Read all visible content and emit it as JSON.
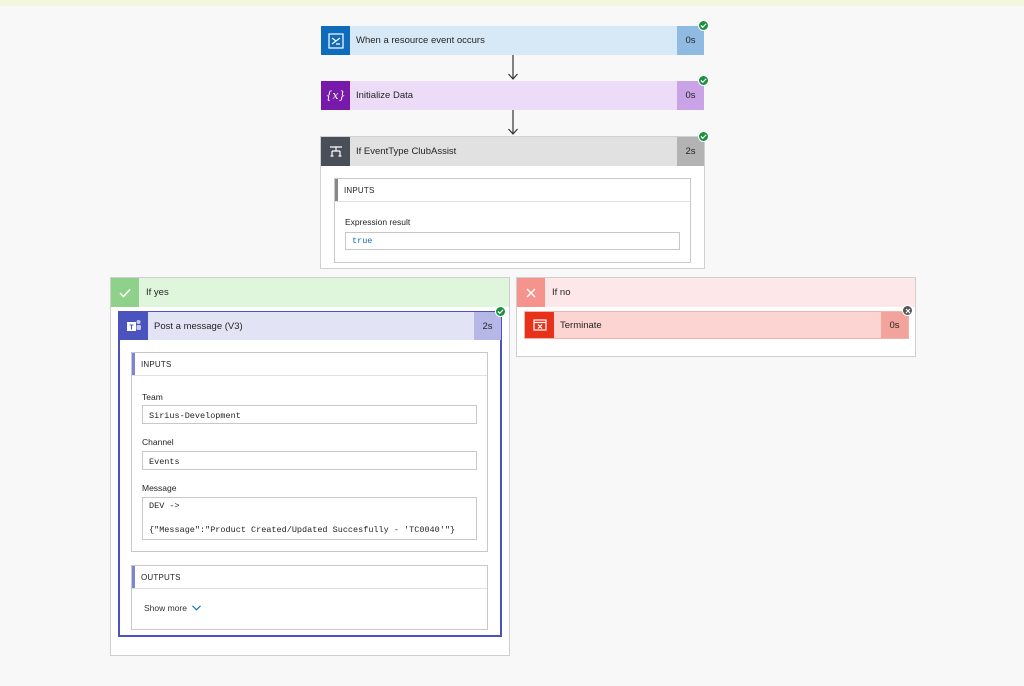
{
  "colors": {
    "trigger_bg": "#d7e9f6",
    "trigger_icon": "#0f6cbd",
    "trigger_dur": "#8fbbe2",
    "init_bg": "#ecdcf8",
    "init_icon": "#7719aa",
    "init_dur": "#c9a3e6",
    "cond_bg": "#e1e1e1",
    "cond_icon": "#484f58",
    "cond_dur": "#b3b3b3",
    "yes_bg": "#dff6dd",
    "yes_icon": "#8fd18b",
    "no_bg": "#fde7e9",
    "no_icon": "#f4948c",
    "teams_bg": "#e2e3f4",
    "teams_icon": "#4b53bc",
    "teams_dur": "#b5b8e6",
    "term_bg": "#fcd4d2",
    "term_icon": "#e8311a",
    "term_dur": "#f2a39b",
    "success": "#1a8f3d"
  },
  "steps": {
    "trigger": {
      "title": "When a resource event occurs",
      "duration": "0s",
      "icon": "event-grid-icon"
    },
    "init": {
      "title": "Initialize Data",
      "duration": "0s",
      "icon": "variable-icon"
    },
    "condition": {
      "title": "If EventType ClubAssist",
      "duration": "2s",
      "icon": "condition-icon",
      "inputs_header": "INPUTS",
      "expression_label": "Expression result",
      "expression_value": "true"
    }
  },
  "branches": {
    "yes": {
      "label": "If yes",
      "icon": "check-icon"
    },
    "no": {
      "label": "If no",
      "icon": "close-icon"
    }
  },
  "post_message": {
    "title": "Post a message (V3)",
    "duration": "2s",
    "icon": "teams-icon",
    "inputs_header": "INPUTS",
    "team_label": "Team",
    "team_value": "Sirius-Development",
    "channel_label": "Channel",
    "channel_value": "Events",
    "message_label": "Message",
    "message_value": "DEV ->\n\n{\"Message\":\"Product Created/Updated Succesfully - 'TC0040'\"}",
    "outputs_header": "OUTPUTS",
    "show_more": "Show more"
  },
  "terminate": {
    "title": "Terminate",
    "duration": "0s",
    "icon": "terminate-icon"
  }
}
